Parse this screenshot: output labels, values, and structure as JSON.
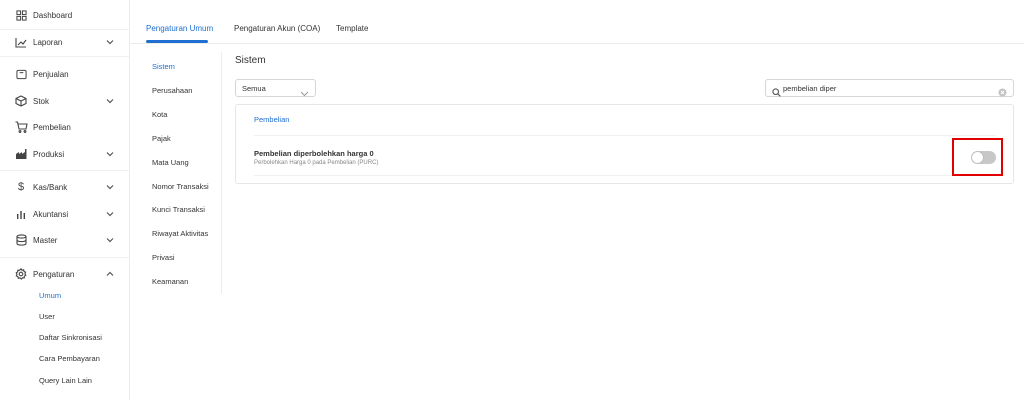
{
  "sidebar": {
    "items": [
      {
        "label": "Dashboard",
        "icon": "grid-icon"
      },
      {
        "label": "Laporan",
        "icon": "line-chart-icon",
        "expandable": true
      },
      {
        "label": "Penjualan",
        "icon": "tag-icon"
      },
      {
        "label": "Stok",
        "icon": "box-icon",
        "expandable": true
      },
      {
        "label": "Pembelian",
        "icon": "cart-icon"
      },
      {
        "label": "Produksi",
        "icon": "factory-icon",
        "expandable": true
      },
      {
        "label": "Kas/Bank",
        "icon": "dollar-icon",
        "expandable": true
      },
      {
        "label": "Akuntansi",
        "icon": "bar-chart-icon",
        "expandable": true
      },
      {
        "label": "Master",
        "icon": "database-icon",
        "expandable": true
      },
      {
        "label": "Pengaturan",
        "icon": "gear-icon",
        "expandable": true,
        "expanded": true
      }
    ],
    "subitems": [
      {
        "label": "Umum",
        "active": true
      },
      {
        "label": "User"
      },
      {
        "label": "Daftar Sinkronisasi"
      },
      {
        "label": "Cara Pembayaran"
      },
      {
        "label": "Query Lain Lain"
      }
    ]
  },
  "tabs": [
    {
      "label": "Pengaturan Umum",
      "active": true
    },
    {
      "label": "Pengaturan Akun (COA)"
    },
    {
      "label": "Template"
    }
  ],
  "submenu": [
    {
      "label": "Sistem",
      "active": true
    },
    {
      "label": "Perusahaan"
    },
    {
      "label": "Kota"
    },
    {
      "label": "Pajak"
    },
    {
      "label": "Mata Uang"
    },
    {
      "label": "Nomor Transaksi"
    },
    {
      "label": "Kunci Transaksi"
    },
    {
      "label": "Riwayat Aktivitas"
    },
    {
      "label": "Privasi"
    },
    {
      "label": "Keamanan"
    }
  ],
  "main": {
    "title": "Sistem",
    "filter": {
      "value": "Semua"
    },
    "search": {
      "value": "pembelian diper"
    },
    "card": {
      "heading": "Pembelian",
      "setting": {
        "title": "Pembelian diperbolehkan harga 0",
        "description": "Perbolehkan Harga 0 pada Pembelian (PURC)",
        "enabled": false
      }
    }
  },
  "colors": {
    "accent": "#1e6fd0",
    "highlight": "#e00000",
    "toggle_off": "#c7c7c7"
  }
}
